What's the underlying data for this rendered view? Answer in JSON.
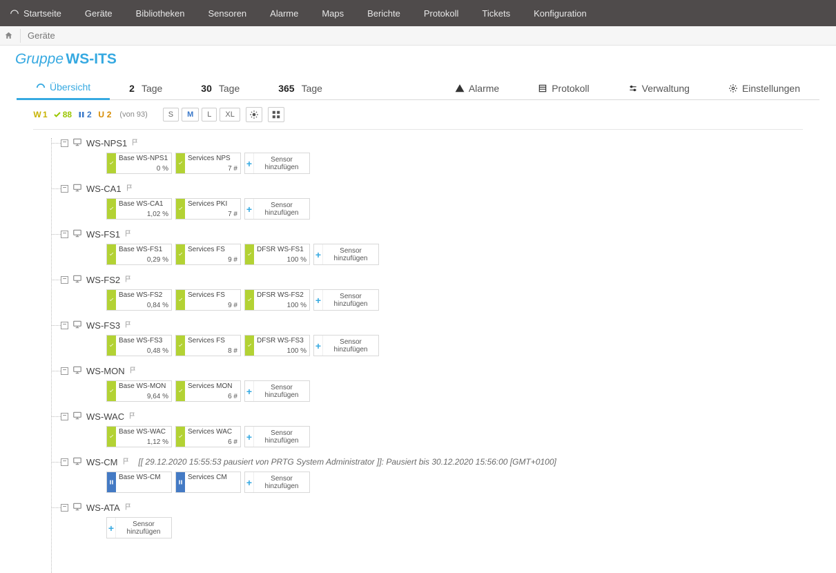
{
  "nav": {
    "items": [
      "Startseite",
      "Geräte",
      "Bibliotheken",
      "Sensoren",
      "Alarme",
      "Maps",
      "Berichte",
      "Protokoll",
      "Tickets",
      "Konfiguration"
    ]
  },
  "breadcrumb": {
    "current": "Geräte"
  },
  "title": {
    "prefix": "Gruppe",
    "name": "WS-ITS"
  },
  "tabs": {
    "overview": "Übersicht",
    "d2_n": "2",
    "d2_l": "Tage",
    "d30_n": "30",
    "d30_l": "Tage",
    "d365_n": "365",
    "d365_l": "Tage",
    "alarms": "Alarme",
    "protokoll": "Protokoll",
    "verwaltung": "Verwaltung",
    "einstellungen": "Einstellungen"
  },
  "stats": {
    "w": "1",
    "ok": "88",
    "paused": "2",
    "unknown": "2",
    "total": "(von 93)"
  },
  "sizes": {
    "s": "S",
    "m": "M",
    "l": "L",
    "xl": "XL"
  },
  "addSensor": {
    "line1": "Sensor",
    "line2": "hinzufügen"
  },
  "devices": [
    {
      "name": "WS-NPS1",
      "sensors": [
        {
          "state": "ok",
          "name": "Base WS-NPS1",
          "val": "0 %"
        },
        {
          "state": "ok",
          "name": "Services NPS",
          "val": "7 #"
        }
      ]
    },
    {
      "name": "WS-CA1",
      "sensors": [
        {
          "state": "ok",
          "name": "Base WS-CA1",
          "val": "1,02 %"
        },
        {
          "state": "ok",
          "name": "Services PKI",
          "val": "7 #"
        }
      ]
    },
    {
      "name": "WS-FS1",
      "sensors": [
        {
          "state": "ok",
          "name": "Base WS-FS1",
          "val": "0,29 %"
        },
        {
          "state": "ok",
          "name": "Services FS",
          "val": "9 #"
        },
        {
          "state": "ok",
          "name": "DFSR WS-FS1",
          "val": "100 %"
        }
      ]
    },
    {
      "name": "WS-FS2",
      "sensors": [
        {
          "state": "ok",
          "name": "Base WS-FS2",
          "val": "0,84 %"
        },
        {
          "state": "ok",
          "name": "Services FS",
          "val": "9 #"
        },
        {
          "state": "ok",
          "name": "DFSR WS-FS2",
          "val": "100 %"
        }
      ]
    },
    {
      "name": "WS-FS3",
      "sensors": [
        {
          "state": "ok",
          "name": "Base WS-FS3",
          "val": "0,48 %"
        },
        {
          "state": "ok",
          "name": "Services FS",
          "val": "8 #"
        },
        {
          "state": "ok",
          "name": "DFSR WS-FS3",
          "val": "100 %"
        }
      ]
    },
    {
      "name": "WS-MON",
      "sensors": [
        {
          "state": "ok",
          "name": "Base WS-MON",
          "val": "9,64 %"
        },
        {
          "state": "ok",
          "name": "Services MON",
          "val": "6 #"
        }
      ]
    },
    {
      "name": "WS-WAC",
      "sensors": [
        {
          "state": "ok",
          "name": "Base WS-WAC",
          "val": "1,12 %"
        },
        {
          "state": "ok",
          "name": "Services WAC",
          "val": "6 #"
        }
      ]
    },
    {
      "name": "WS-CM",
      "note": "[[ 29.12.2020 15:55:53 pausiert von PRTG System Administrator ]]: Pausiert bis 30.12.2020 15:56:00 [GMT+0100]",
      "sensors": [
        {
          "state": "paused",
          "name": "Base WS-CM",
          "val": ""
        },
        {
          "state": "paused",
          "name": "Services CM",
          "val": ""
        }
      ]
    },
    {
      "name": "WS-ATA",
      "sensors": []
    }
  ]
}
